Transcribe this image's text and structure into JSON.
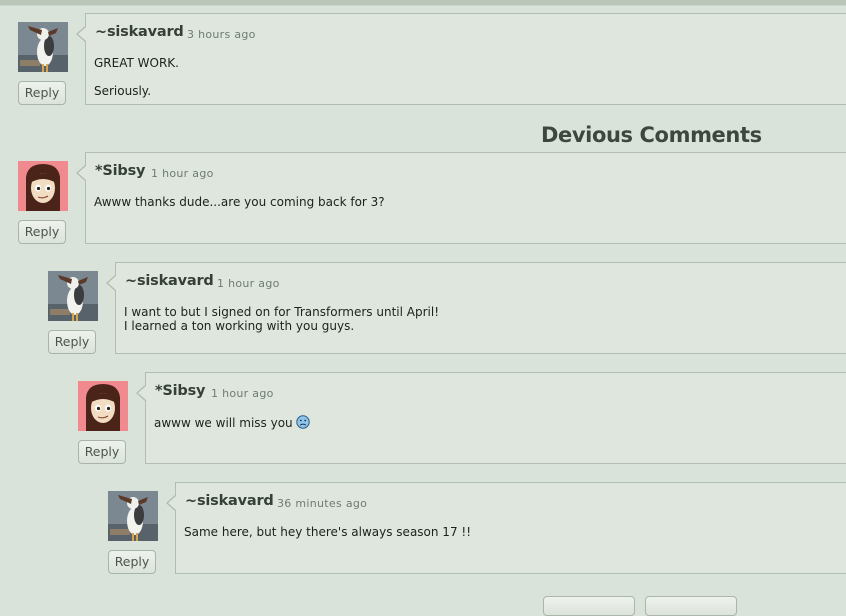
{
  "section_title": "Devious Comments",
  "reply_label": "Reply",
  "comments": [
    {
      "author": "~siskavard",
      "time": "3 hours ago",
      "lines": [
        "GREAT WORK.",
        "Seriously."
      ],
      "avatar": "seagull-avatar"
    },
    {
      "author": "*Sibsy",
      "time": "1 hour ago",
      "lines": [
        "Awww thanks dude...are you coming back for 3?"
      ],
      "avatar": "girl-avatar"
    },
    {
      "author": "~siskavard",
      "time": "1 hour ago",
      "lines": [
        "I want to but I signed on for Transformers until April!",
        "I learned a ton working with you guys."
      ],
      "avatar": "seagull-avatar"
    },
    {
      "author": "*Sibsy",
      "time": "1 hour ago",
      "lines": [
        "awww we will miss you"
      ],
      "avatar": "girl-avatar",
      "emoticon": "sad-face-icon"
    },
    {
      "author": "~siskavard",
      "time": "36 minutes ago",
      "lines": [
        "Same here, but hey there's always season 17 !!"
      ],
      "avatar": "seagull-avatar"
    }
  ]
}
